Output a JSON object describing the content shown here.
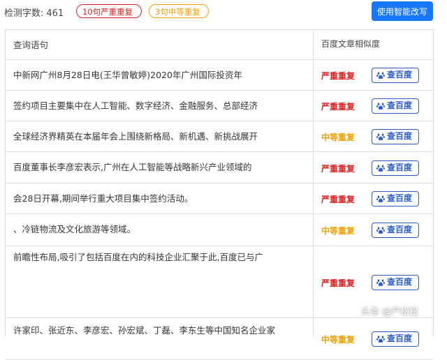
{
  "header": {
    "count_label": "检测字数:",
    "count_value": "461",
    "severe_pill": "10句严重重复",
    "medium_pill": "3句中等重复",
    "rewrite_button": "使用智能改写"
  },
  "table": {
    "col_query": "查询语句",
    "col_similarity": "百度文章相似度",
    "rows": [
      {
        "text": "中新网广州8月28日电(王华曾敏婷)2020年广州国际投资年",
        "status": "严重重复",
        "level": "severe",
        "button": "查百度"
      },
      {
        "text": "签约项目主要集中在人工智能、数字经济、金融服务、总部经济",
        "status": "严重重复",
        "level": "severe",
        "button": "查百度"
      },
      {
        "text": "全球经济界精英在本届年会上围绕新格局、新机遇、新挑战展开",
        "status": "中等重复",
        "level": "medium",
        "button": "查百度"
      },
      {
        "text": "百度董事长李彦宏表示,广州在人工智能等战略新兴产业领域的",
        "status": "严重重复",
        "level": "severe",
        "button": "查百度"
      },
      {
        "text": "会28日开幕,期间举行重大项目集中签约活动。",
        "status": "严重重复",
        "level": "severe",
        "button": "查百度"
      },
      {
        "text": "、冷链物流及文化旅游等领域。",
        "status": "中等重复",
        "level": "medium",
        "button": "查百度"
      },
      {
        "text": "前瞻性布局,吸引了包括百度在内的科技企业汇聚于此,百度已与广",
        "status": "严重重复",
        "level": "severe",
        "button": "查百度"
      },
      {
        "text": "许家印、张近东、李彦宏、孙宏斌、丁磊、李东生等中国知名企业家",
        "status": "中等重复",
        "level": "medium",
        "button": "查百度"
      }
    ]
  },
  "watermark": "头条 @严松松",
  "colors": {
    "severe": "#e02020",
    "medium": "#f0a000",
    "primary": "#1677ff",
    "baidu": "#2a5cd0"
  }
}
